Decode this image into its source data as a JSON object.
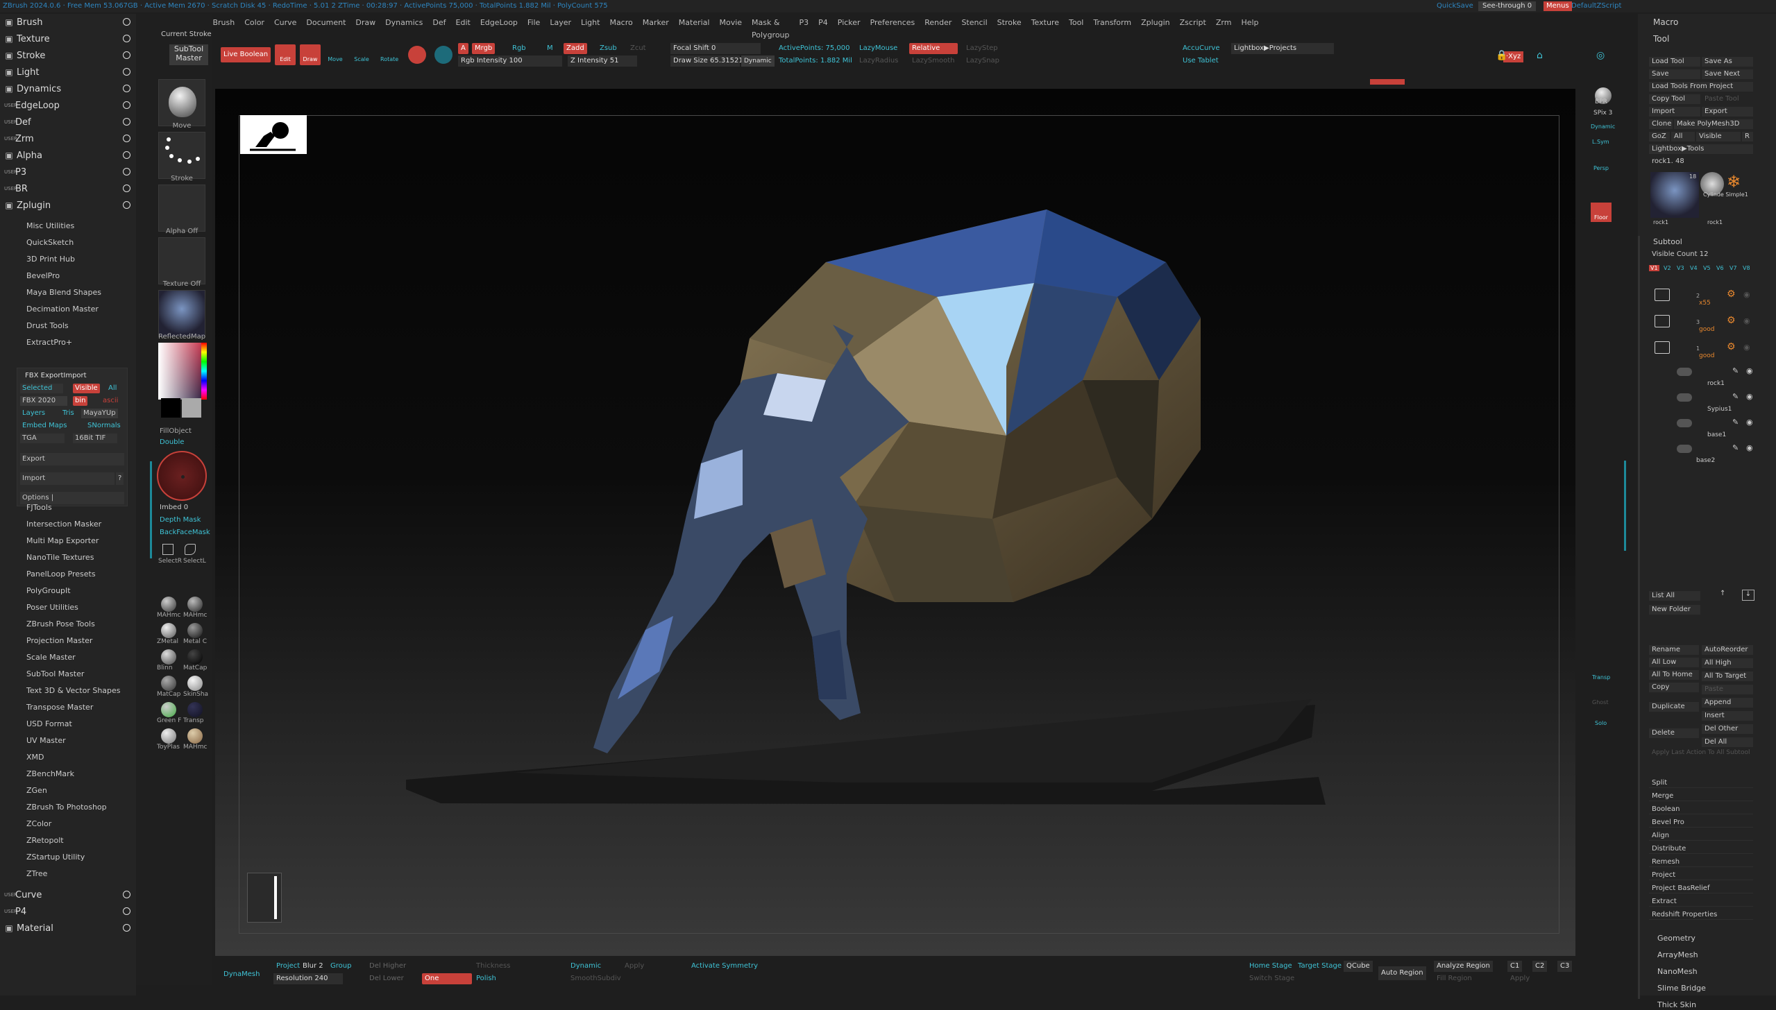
{
  "topbar": {
    "info": "ZBrush 2024.0.6   · Free Mem 53.067GB · Active Mem 2670 · Scratch Disk 45 · RedoTime · 5.01 2 ZTime · 00:28:97 · ActivePoints 75,000 · TotalPoints 1.882 Mil · PolyCount 575",
    "seethrough_label": "See-through  0",
    "menus_label": "Menus",
    "default_zscript": "DefaultZScript",
    "quicksave": "QuickSave"
  },
  "menubar": [
    "Alpha",
    "BR",
    "Brush",
    "Color",
    "Curve",
    "Document",
    "Draw",
    "Dynamics",
    "Def",
    "Edit",
    "EdgeLoop",
    "File",
    "Layer",
    "Light",
    "Macro",
    "Marker",
    "Material",
    "Movie",
    "Mask & Polygroup",
    "P3",
    "P4",
    "Picker",
    "Preferences",
    "Render",
    "Stencil",
    "Stroke",
    "Texture",
    "Tool",
    "Transform",
    "Zplugin",
    "Zscript",
    "Zrm",
    "Help"
  ],
  "left_menu": [
    {
      "label": "Brush",
      "user": "",
      "icon": "brush-icon"
    },
    {
      "label": "Texture",
      "user": "",
      "icon": "texture-icon"
    },
    {
      "label": "Stroke",
      "user": "",
      "icon": "stroke-icon"
    },
    {
      "label": "Light",
      "user": "",
      "icon": "light-icon"
    },
    {
      "label": "Dynamics",
      "user": "",
      "icon": "dynamics-icon"
    },
    {
      "label": "EdgeLoop",
      "user": "USER",
      "icon": ""
    },
    {
      "label": "Def",
      "user": "USER",
      "icon": ""
    },
    {
      "label": "Zrm",
      "user": "USER",
      "icon": ""
    },
    {
      "label": "Alpha",
      "user": "",
      "icon": "alpha-icon"
    },
    {
      "label": "P3",
      "user": "USER",
      "icon": ""
    },
    {
      "label": "BR",
      "user": "USER",
      "icon": ""
    },
    {
      "label": "Zplugin",
      "user": "",
      "icon": "zplugin-icon"
    }
  ],
  "zplugin_items_top": [
    "Misc Utilities",
    "QuickSketch",
    "3D Print Hub",
    "BevelPro",
    "Maya Blend Shapes",
    "Decimation Master",
    "Drust Tools",
    "ExtractPro+"
  ],
  "fbx": {
    "title": "FBX ExportImport",
    "selected": "Selected",
    "visible": "Visible",
    "all": "All",
    "fbx2020": "FBX 2020",
    "bin": "bin",
    "ascii": "ascii",
    "layers": "Layers",
    "tris": "Tris",
    "mayayup": "MayaYUp",
    "embed": "Embed Maps",
    "smooth": "SNormals",
    "tga": "TGA",
    "tif": "16Bit TIF",
    "export": "Export",
    "import": "Import",
    "q": "?",
    "options": "Options |"
  },
  "zplugin_items_bottom": [
    "FJTools",
    "Intersection Masker",
    "Multi Map Exporter",
    "NanoTile Textures",
    "PanelLoop Presets",
    "PolyGroupIt",
    "Poser Utilities",
    "ZBrush Pose Tools",
    "Projection Master",
    "Scale Master",
    "SubTool Master",
    "Text 3D & Vector Shapes",
    "Transpose Master",
    "USD Format",
    "UV Master",
    "XMD",
    "ZBenchMark",
    "ZGen",
    "ZBrush To Photoshop",
    "ZColor",
    "ZRetopolt",
    "ZStartup Utility",
    "ZTree"
  ],
  "left_menu_bottom": [
    {
      "label": "Curve",
      "user": "USER"
    },
    {
      "label": "P4",
      "user": "USER"
    },
    {
      "label": "Material",
      "user": ""
    }
  ],
  "brushcol": {
    "current_stroke": "Current Stroke",
    "move": "Move",
    "stroke": "Stroke",
    "alpha_off": "Alpha Off",
    "texture_off": "Texture Off",
    "reflectedmap": "ReflectedMap",
    "fillobject": "FillObject",
    "double": "Double",
    "imbed": "Imbed 0",
    "depth_mask": "Depth Mask",
    "backface_mask": "BackFaceMask",
    "selectr": "SelectR",
    "selectl": "SelectL",
    "materials": [
      "MAHmc",
      "MAHmc",
      "ZMetal",
      "Metal C",
      "Blinn",
      "MatCap",
      "MatCap",
      "SkinSha",
      "Green F",
      "Transp",
      "ToyPlas",
      "MAHmc"
    ]
  },
  "toolbar": {
    "subtool_master": "SubTool Master",
    "live_boolean": "Live Boolean",
    "edit": "Edit",
    "draw": "Draw",
    "move": "Move",
    "scale": "Scale",
    "rotate": "Rotate",
    "a": "A",
    "mrgb": "Mrgb",
    "rgb": "Rgb",
    "m": "M",
    "zadd": "Zadd",
    "zsub": "Zsub",
    "zcut": "Zcut",
    "rgb_intensity": "Rgb Intensity 100",
    "z_intensity": "Z Intensity 51",
    "focal_shift": "Focal Shift 0",
    "draw_size": "Draw Size 65.31521",
    "dynamic": "Dynamic",
    "active_points": "ActivePoints: 75,000",
    "total_points": "TotalPoints: 1.882 Mil",
    "lazymouse": "LazyMouse",
    "lazyradius": "LazyRadius",
    "relative": "Relative",
    "lazystep": "LazyStep",
    "lazysmooth": "LazySmooth",
    "lazysnap": "LazySnap",
    "accucurve": "AccuCurve",
    "use_tablet": "Use Tablet",
    "lightbox_projects": "Lightbox▶Projects",
    "xyz": "·Xyz"
  },
  "right_strip": {
    "bpr": "BPR",
    "spix": "SPix 3",
    "dynamic": "Dynamic",
    "persp": "Persp",
    "floor": "Floor",
    "l_sym": "L.Sym",
    "transp": "Transp",
    "ghost": "Ghost",
    "solo": "Solo"
  },
  "right_panel": {
    "macro": "Macro",
    "tool": "Tool",
    "load_tool": "Load Tool",
    "save_as": "Save As",
    "save": "Save",
    "save_next": "Save Next",
    "load_tools_from_project": "Load Tools From Project",
    "copy_tool": "Copy Tool",
    "paste_tool": "Paste Tool",
    "import": "Import",
    "export": "Export",
    "clone": "Clone",
    "make_polymesh": "Make PolyMesh3D",
    "goz": "GoZ",
    "all": "All",
    "visible": "Visible",
    "r": "R",
    "lightbox_tools": "Lightbox▶Tools",
    "rock": "rock1. 48",
    "thumb1": "rock1",
    "thumb2": "Cylinde Simple1",
    "thumb3": "rock1",
    "count18": "18",
    "subtool": "Subtool",
    "visible_count": "Visible Count 12",
    "versions": [
      "V1",
      "V2",
      "V3",
      "V4",
      "V5",
      "V6",
      "V7",
      "V8"
    ],
    "folders": [
      {
        "name": "x55",
        "n": "2"
      },
      {
        "name": "good",
        "n": "3"
      },
      {
        "name": "good",
        "n": "1"
      }
    ],
    "subtools": [
      "rock1",
      "Sypius1",
      "base1",
      "base2"
    ],
    "list_all": "List All",
    "new_folder": "New Folder",
    "ops_left": [
      "Rename",
      "All Low",
      "All To Home",
      "Copy",
      "Duplicate",
      "Delete"
    ],
    "ops_right": [
      "AutoReorder",
      "All High",
      "All To Target",
      "Paste",
      "Append",
      "Insert",
      "Del Other",
      "Del All"
    ],
    "apply_last": "Apply Last Action To All Subtool",
    "ops": [
      "Split",
      "Merge",
      "Boolean",
      "Bevel Pro",
      "Align",
      "Distribute",
      "Remesh",
      "Project",
      "Project BasRelief",
      "Extract",
      "Redshift Properties"
    ],
    "sections": [
      "Geometry",
      "ArrayMesh",
      "NanoMesh",
      "Slime Bridge",
      "Thick Skin"
    ]
  },
  "bottombar": {
    "dynamesh": "DynaMesh",
    "project": "Project",
    "blur": "Blur 2",
    "group": "Group",
    "resolution": "Resolution 240",
    "del_higher": "Del Higher",
    "del_lower": "Del Lower",
    "thickness": "Thickness",
    "one": "One",
    "polish": "Polish",
    "dynamic": "Dynamic",
    "apply": "Apply",
    "smooth_subdiv": "SmoothSubdiv",
    "activate_symmetry": "Activate Symmetry",
    "home_stage": "Home Stage",
    "target_stage": "Target Stage",
    "switch_stage": "Switch Stage",
    "qcube": "QCube",
    "auto_region": "Auto Region",
    "analyze_region": "Analyze Region",
    "fill_region": "Fill Region",
    "c1": "C1",
    "c2": "C2",
    "c3": "C3",
    "apply2": "Apply"
  }
}
